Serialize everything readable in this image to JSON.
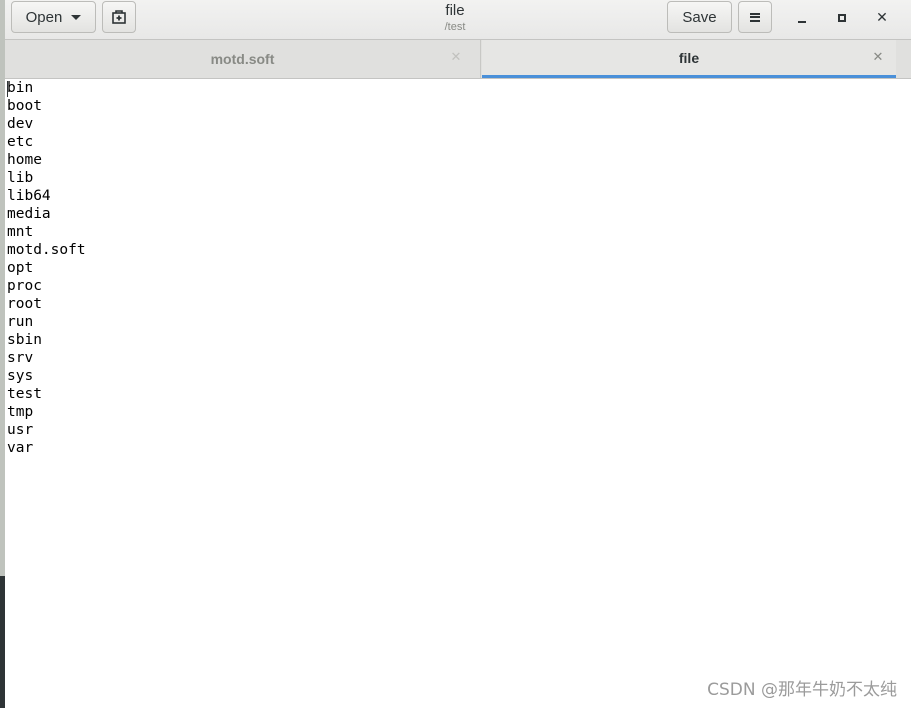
{
  "window": {
    "title": "file",
    "subtitle": "/test"
  },
  "toolbar": {
    "open_label": "Open",
    "new_tab_icon": "new-document-icon",
    "save_label": "Save",
    "menu_icon": "hamburger-menu-icon"
  },
  "window_controls": {
    "minimize_icon": "minimize-icon",
    "maximize_icon": "maximize-icon",
    "close_icon": "close-icon",
    "close_glyph": "✕"
  },
  "tabs": [
    {
      "label": "motd.soft",
      "close_glyph": "✕",
      "active": false
    },
    {
      "label": "file",
      "close_glyph": "✕",
      "active": true
    }
  ],
  "document": {
    "lines": [
      "bin",
      "boot",
      "dev",
      "etc",
      "home",
      "lib",
      "lib64",
      "media",
      "mnt",
      "motd.soft",
      "opt",
      "proc",
      "root",
      "run",
      "sbin",
      "srv",
      "sys",
      "test",
      "tmp",
      "usr",
      "var"
    ]
  },
  "watermark": "CSDN @那年牛奶不太纯",
  "colors": {
    "accent": "#4a90d9",
    "text": "#2e3436",
    "muted": "#888a85"
  }
}
